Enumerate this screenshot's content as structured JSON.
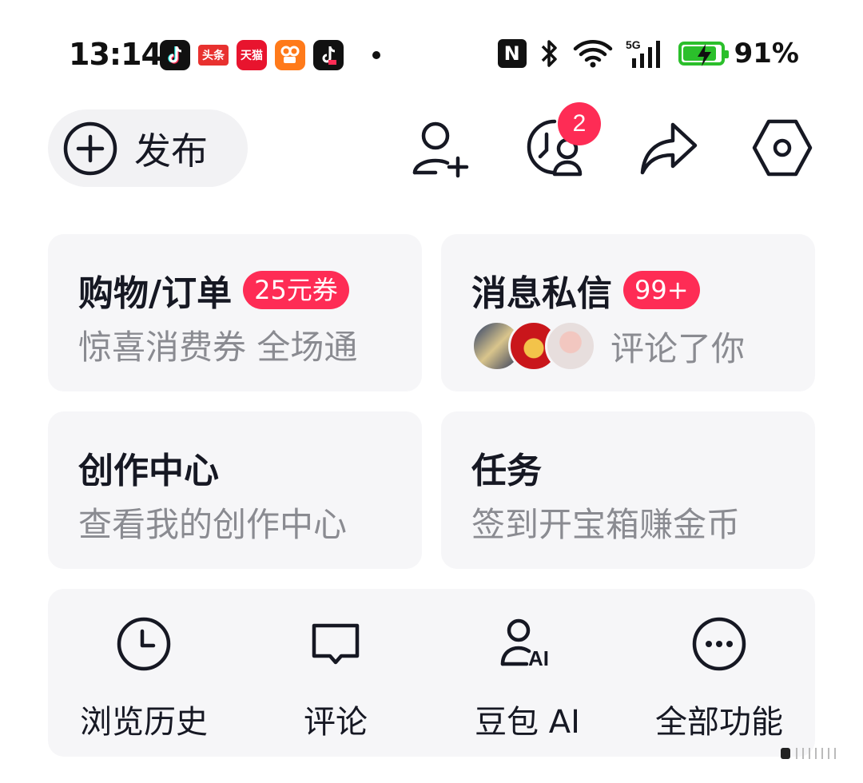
{
  "status_bar": {
    "time": "13:14",
    "notification_apps": [
      "douyin-icon",
      "toutiao-icon",
      "tmall-icon",
      "kuaishou-icon",
      "douyin-lite-icon"
    ],
    "notif_text": {
      "toutiao": "头条",
      "tmall": "天猫"
    },
    "battery_percent": "91%",
    "battery_level": 0.91,
    "network": "5G"
  },
  "header": {
    "publish_label": "发布",
    "notification_badge": "2"
  },
  "cards": {
    "shopping": {
      "title": "购物/订单",
      "badge": "25元券",
      "subtitle": "惊喜消费券 全场通"
    },
    "messages": {
      "title": "消息私信",
      "badge": "99+",
      "subtitle": "评论了你"
    },
    "creator": {
      "title": "创作中心",
      "subtitle": "查看我的创作中心"
    },
    "tasks": {
      "title": "任务",
      "subtitle": "签到开宝箱赚金币"
    }
  },
  "tools": [
    {
      "label": "浏览历史",
      "icon": "history-clock-icon"
    },
    {
      "label": "评论",
      "icon": "comment-bubble-icon"
    },
    {
      "label": "豆包 AI",
      "icon": "doubao-ai-icon"
    },
    {
      "label": "全部功能",
      "icon": "more-dots-icon"
    }
  ],
  "colors": {
    "accent_red": "#fe2c55",
    "card_bg": "#f6f6f8",
    "battery_green": "#2bbf2b",
    "subtitle_gray": "#8a8b91"
  }
}
